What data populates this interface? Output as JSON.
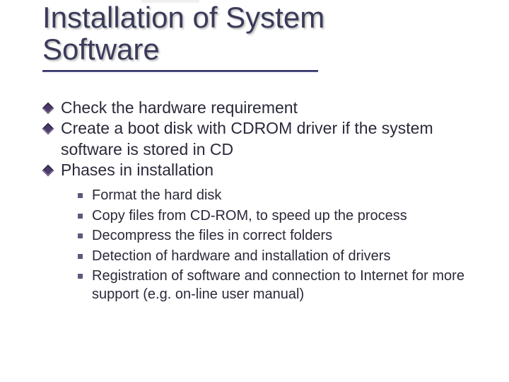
{
  "title_line1": "Installation of System",
  "title_line2": "Software",
  "bullets": [
    {
      "text": "Check the hardware requirement"
    },
    {
      "text": "Create a boot disk with CDROM driver if the system software is stored in CD"
    },
    {
      "text": "Phases in installation"
    }
  ],
  "sub_bullets": [
    {
      "text": "Format the hard disk"
    },
    {
      "text": "Copy files from CD-ROM, to speed up the process"
    },
    {
      "text": "Decompress the files in correct folders"
    },
    {
      "text": "Detection of hardware and installation of drivers"
    },
    {
      "text": "Registration of software and connection to Internet for more support (e.g. on-line user manual)"
    }
  ]
}
